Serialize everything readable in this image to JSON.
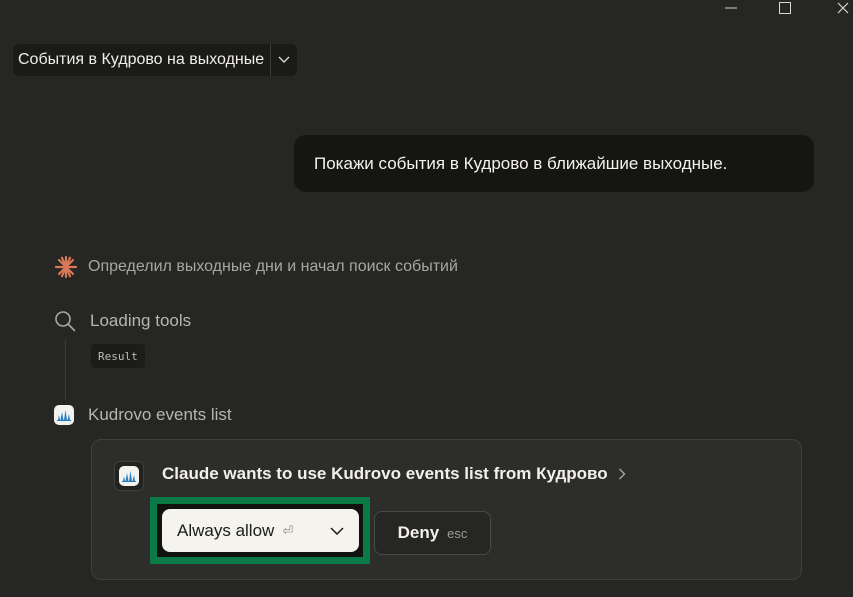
{
  "window": {
    "minimize_icon": "minimize-icon",
    "maximize_icon": "maximize-icon",
    "close_icon": "close-icon"
  },
  "conversation": {
    "title": "События в Кудрово на выходные",
    "title_menu_icon": "chevron-down-icon"
  },
  "messages": {
    "user": "Покажи события в Кудрово в ближайшие выходные."
  },
  "assistant": {
    "status_icon": "claude-spark-icon",
    "status": "Определил выходные дни и начал поиск событий",
    "steps": [
      {
        "icon": "search-icon",
        "label": "Loading tools",
        "tag": "Result"
      },
      {
        "icon": "kudrovo-app-icon",
        "label": "Kudrovo events list"
      }
    ]
  },
  "permission": {
    "app_icon": "kudrovo-app-icon",
    "prompt": "Claude wants to use Kudrovo events list from Кудрово",
    "expand_icon": "chevron-right-icon",
    "allow_label": "Always allow",
    "allow_key_icon": "enter-key-icon",
    "allow_menu_icon": "chevron-down-icon",
    "deny_label": "Deny",
    "deny_key": "esc"
  },
  "colors": {
    "background": "#262624",
    "user_bubble": "#151513",
    "card": "#2d2d2b",
    "spark": "#d97757",
    "highlight": "#0b7a46",
    "app_icon_blue": "#2a7fc0"
  }
}
